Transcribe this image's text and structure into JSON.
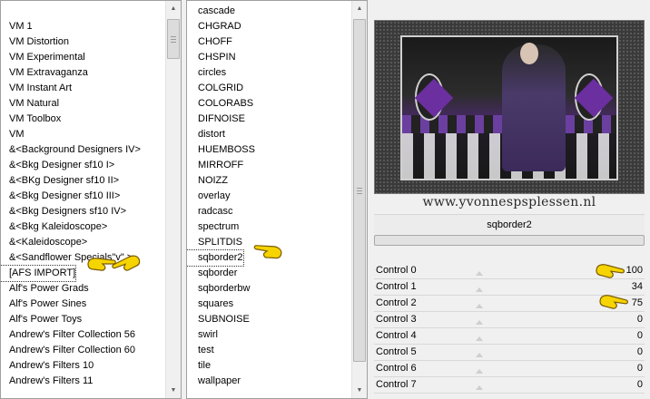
{
  "category_list": {
    "items": [
      "VM 1",
      "VM Distortion",
      "VM Experimental",
      "VM Extravaganza",
      "VM Instant Art",
      "VM Natural",
      "VM Toolbox",
      "VM",
      "&<Background Designers IV>",
      "&<Bkg Designer sf10 I>",
      "&<BKg Designer sf10 II>",
      "&<Bkg Designer sf10 III>",
      "&<Bkg Designers sf10 IV>",
      "&<Bkg Kaleidoscope>",
      "&<Kaleidoscope>",
      "&<Sandflower Specials\"v\" >",
      "[AFS IMPORT]",
      "Alf's Power Grads",
      "Alf's Power Sines",
      "Alf's Power Toys",
      "Andrew's Filter Collection 56",
      "Andrew's Filter Collection 60",
      "Andrew's Filters 10",
      "Andrew's Filters 11"
    ],
    "selected_index": 16
  },
  "filter_list": {
    "items": [
      "cascade",
      "CHGRAD",
      "CHOFF",
      "CHSPIN",
      "circles",
      "COLGRID",
      "COLORABS",
      "DIFNOISE",
      "distort",
      "HUEMBOSS",
      "MIRROFF",
      "NOIZZ",
      "overlay",
      "radcasc",
      "spectrum",
      "SPLITDIS",
      "sqborder2",
      "sqborder",
      "sqborderbw",
      "squares",
      "SUBNOISE",
      "swirl",
      "test",
      "tile",
      "wallpaper"
    ],
    "selected_index": 16
  },
  "preview": {
    "watermark": "www.yvonnespsplessen.nl"
  },
  "filter_title": "sqborder2",
  "controls": [
    {
      "label": "Control 0",
      "value": "100"
    },
    {
      "label": "Control 1",
      "value": "34"
    },
    {
      "label": "Control 2",
      "value": "75"
    },
    {
      "label": "Control 3",
      "value": "0"
    },
    {
      "label": "Control 4",
      "value": "0"
    },
    {
      "label": "Control 5",
      "value": "0"
    },
    {
      "label": "Control 6",
      "value": "0"
    },
    {
      "label": "Control 7",
      "value": "0"
    }
  ],
  "colors": {
    "pointer_fill": "#f5d400",
    "pointer_outline": "#7a5a00",
    "preview_accent": "#6b2fa0"
  },
  "icons": {
    "scroll_up": "arrow-up-icon",
    "scroll_down": "arrow-down-icon",
    "pointer": "pointing-hand-icon"
  }
}
